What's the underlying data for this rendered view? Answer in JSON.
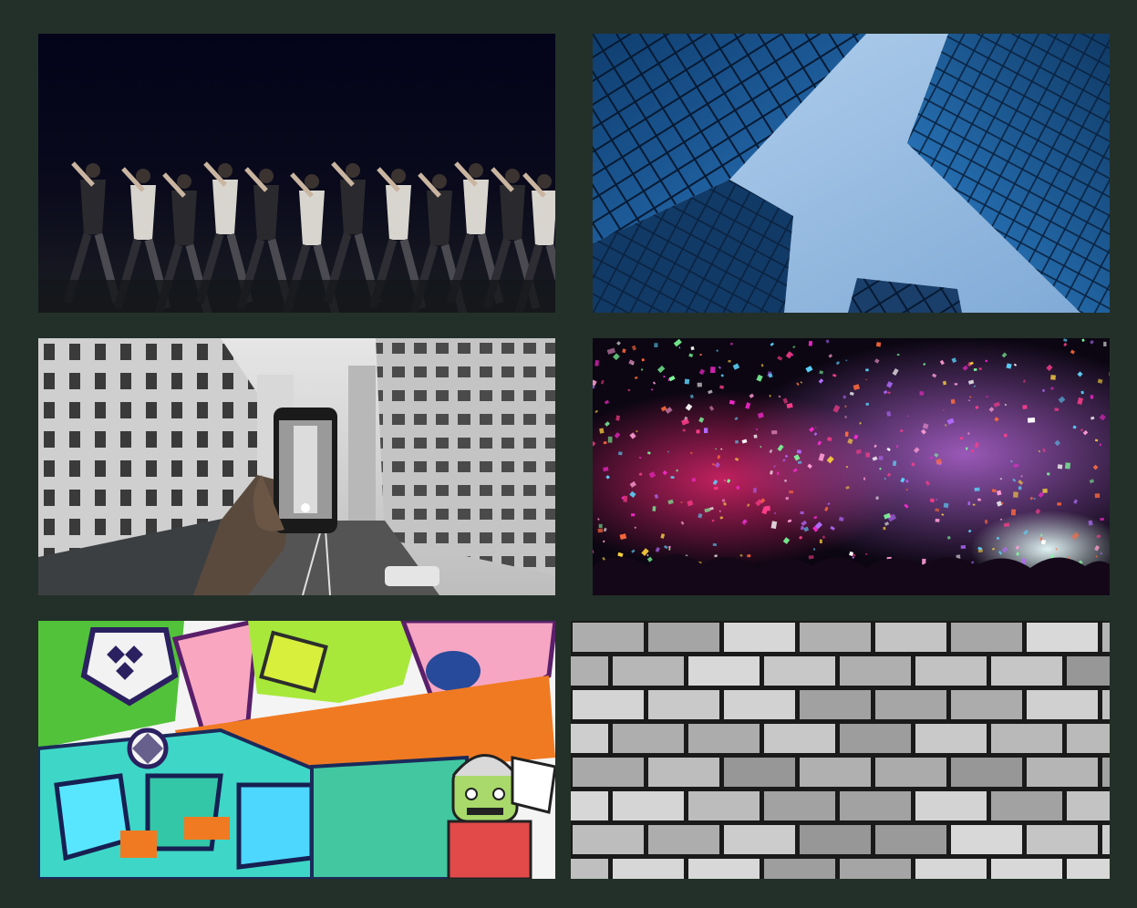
{
  "tiles": [
    {
      "id": "dance",
      "icon": "dance-crew-photo"
    },
    {
      "id": "sky",
      "icon": "skyscrapers-photo"
    },
    {
      "id": "phone",
      "icon": "phone-street-photo"
    },
    {
      "id": "confetti",
      "icon": "confetti-concert-photo"
    },
    {
      "id": "graffiti",
      "icon": "graffiti-wall-photo"
    },
    {
      "id": "brick",
      "icon": "brick-wall-photo"
    }
  ],
  "colors": {
    "background": "#233029",
    "dance_bg": "#05051a",
    "sky": "#9cc3e6",
    "glass": "#1b5c9a",
    "confetti_bg": "#0b0612",
    "brick": "#9a9a9a"
  }
}
